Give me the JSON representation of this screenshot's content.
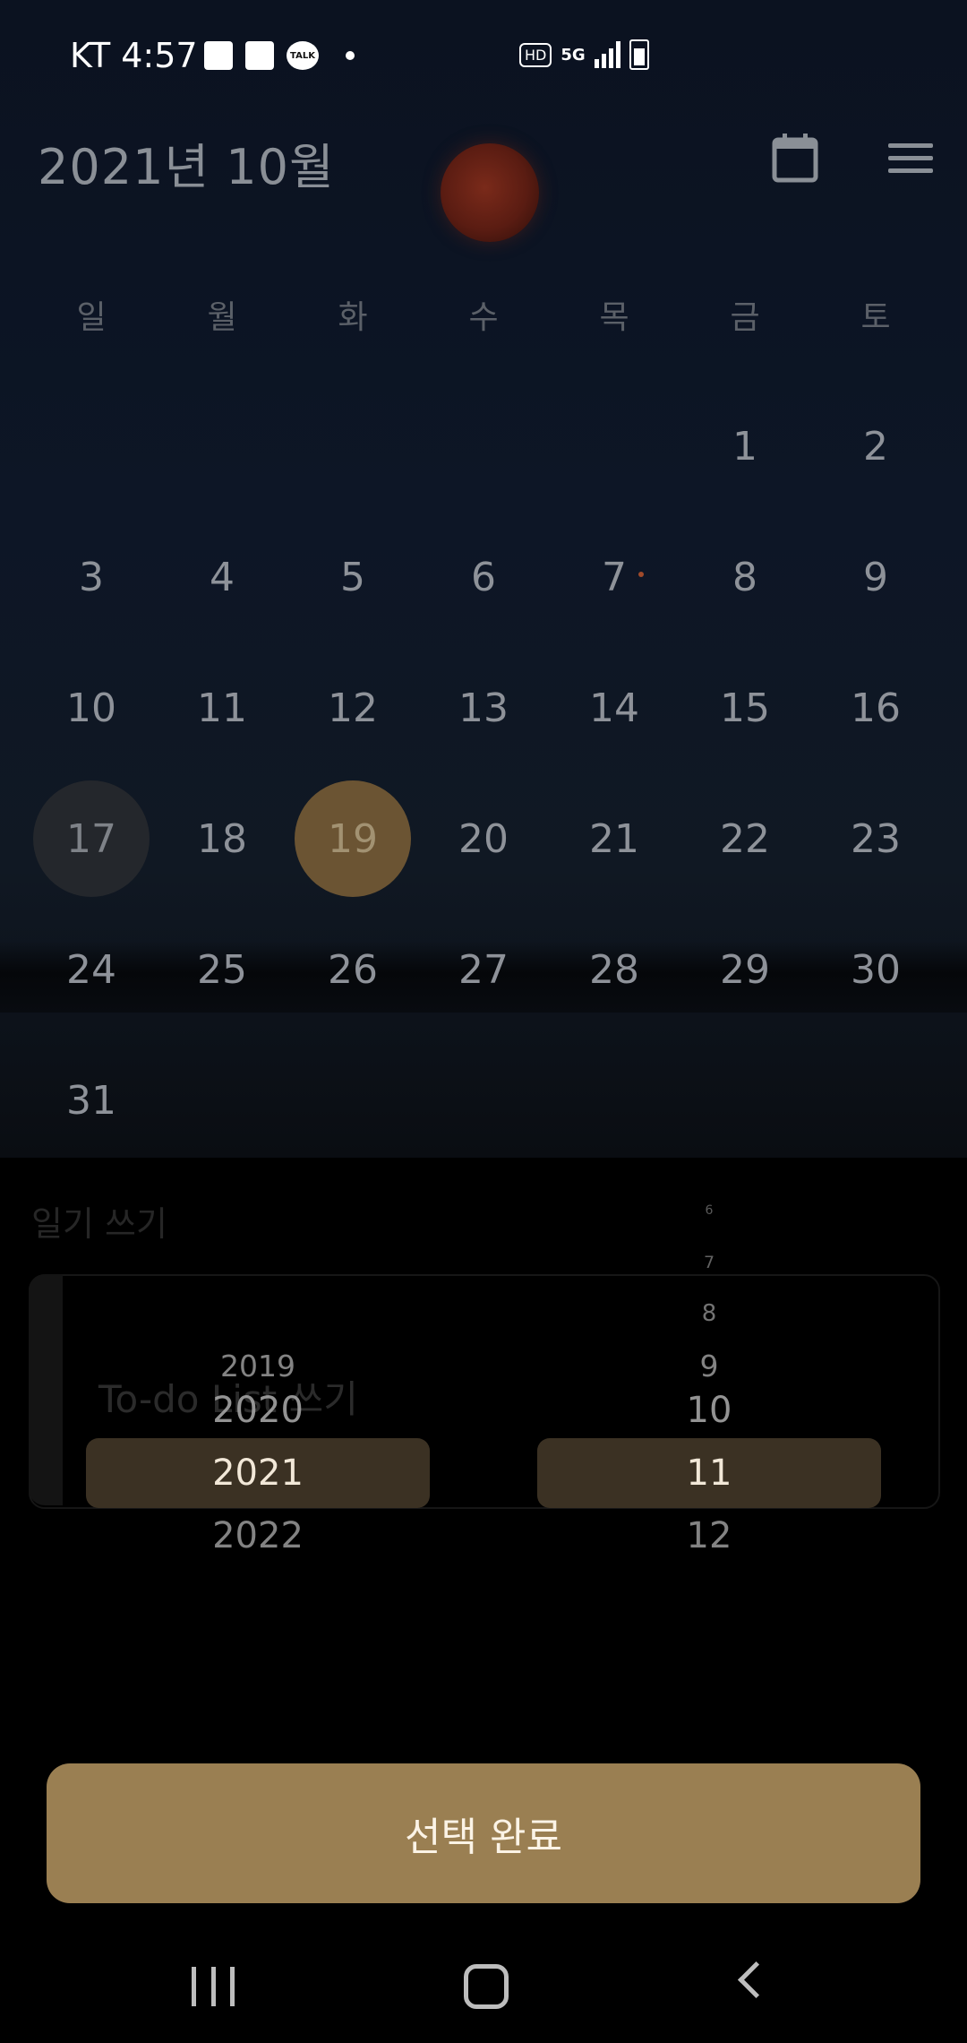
{
  "status_bar": {
    "carrier_time": "KT 4:57",
    "notification_icons": [
      "gallery-icon",
      "memo-icon",
      "kakaotalk-icon",
      "dot-icon"
    ],
    "talk_label": "TALK",
    "system_icons": [
      "hd-voice-icon",
      "5g-icon",
      "signal-icon",
      "battery-charging-icon"
    ],
    "hd_label": "HD",
    "network_label": "5G"
  },
  "header": {
    "title": "2021년 10월",
    "calendar_button_icon": "calendar-icon",
    "menu_button_icon": "menu-icon"
  },
  "calendar": {
    "weekdays": [
      "일",
      "월",
      "화",
      "수",
      "목",
      "금",
      "토"
    ],
    "today": "17",
    "selected": "19",
    "weeks": [
      [
        "",
        "",
        "",
        "",
        "",
        "1",
        "2"
      ],
      [
        "3",
        "4",
        "5",
        "6",
        "7",
        "8",
        "9"
      ],
      [
        "10",
        "11",
        "12",
        "13",
        "14",
        "15",
        "16"
      ],
      [
        "17",
        "18",
        "19",
        "20",
        "21",
        "22",
        "23"
      ],
      [
        "24",
        "25",
        "26",
        "27",
        "28",
        "29",
        "30"
      ],
      [
        "31",
        "",
        "",
        "",
        "",
        "",
        ""
      ]
    ]
  },
  "sections": {
    "diary_label": "일기 쓰기",
    "todo_label": "To-do List 쓰기"
  },
  "picker": {
    "years": [
      "2019",
      "2020",
      "2021",
      "2022"
    ],
    "selected_year": "2021",
    "months": [
      "6",
      "7",
      "8",
      "9",
      "10",
      "11",
      "12"
    ],
    "selected_month": "11"
  },
  "confirm_button": {
    "label": "선택 완료"
  },
  "colors": {
    "accent": "#9a7f52",
    "picker_highlight": "#3b3123",
    "selected_day": "#6b5433"
  },
  "nav": {
    "recent_icon": "recent-apps-icon",
    "home_icon": "home-icon",
    "back_icon": "back-icon"
  }
}
